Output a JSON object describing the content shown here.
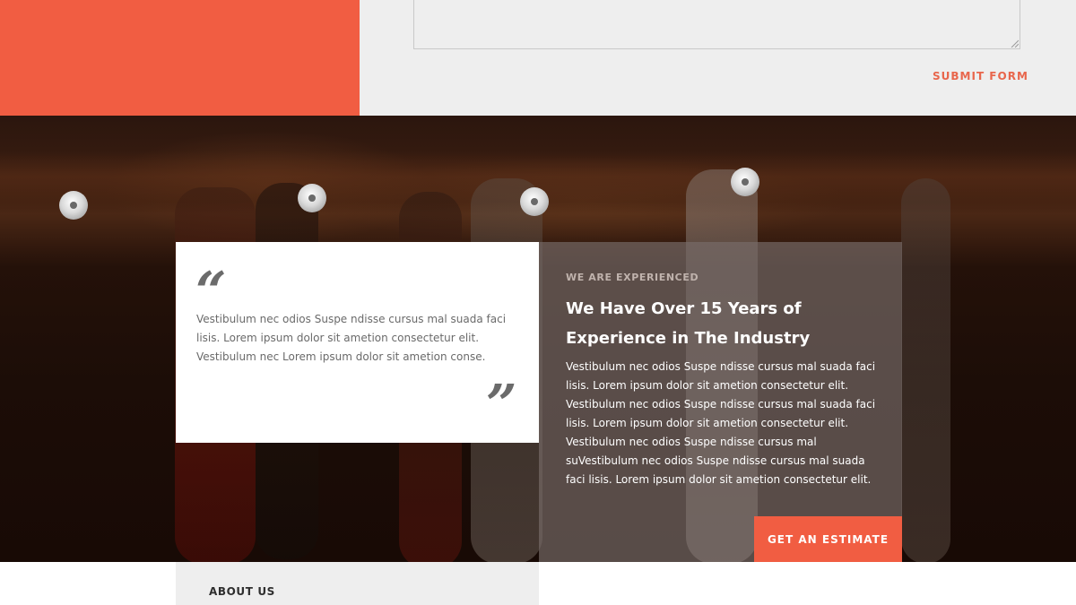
{
  "form": {
    "submit_label": "SUBMIT FORM"
  },
  "testimonial": {
    "quote_text": "Vestibulum nec odios Suspe ndisse cursus mal suada faci lisis. Lorem ipsum dolor sit ametion consectetur elit. Vestibulum nec Lorem ipsum dolor sit ametion conse.",
    "open_mark": "“",
    "close_mark": "”"
  },
  "experience": {
    "eyebrow": "WE ARE EXPERIENCED",
    "heading": "We Have Over 15 Years of Experience in The Industry",
    "body": "Vestibulum nec odios Suspe ndisse cursus mal suada faci lisis. Lorem ipsum dolor sit ametion consectetur elit. Vestibulum nec odios Suspe ndisse cursus mal suada faci lisis. Lorem ipsum dolor sit ametion consectetur elit. Vestibulum nec odios Suspe ndisse cursus mal suVestibulum nec odios Suspe ndisse cursus mal suada faci lisis. Lorem ipsum dolor sit ametion consectetur elit.",
    "cta_label": "GET AN ESTIMATE"
  },
  "about": {
    "label": "ABOUT US"
  },
  "colors": {
    "accent": "#f15d42",
    "light_bg": "#eeeeee",
    "dark_bg": "#1c0d07"
  },
  "icons": {
    "quote_open": "quote-open-icon",
    "quote_close": "quote-close-icon",
    "resize_grip": "resize-grip-icon"
  }
}
